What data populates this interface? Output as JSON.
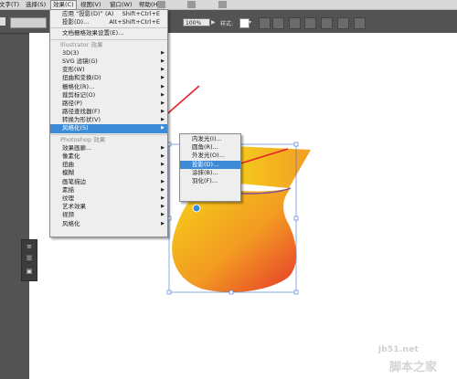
{
  "menubar": {
    "items": [
      "文字(T)",
      "选择(S)",
      "效果(C)",
      "视图(V)",
      "窗口(W)",
      "帮助(H)"
    ],
    "active": "效果(C)"
  },
  "controlbar": {
    "opacity": "100%",
    "style_label": "样式:"
  },
  "effect_menu": {
    "apply_last": "应用 “投影(D)” (A)",
    "apply_last_shortcut": "Shift+Ctrl+E",
    "last_effect": "投影(D)...",
    "last_effect_shortcut": "Alt+Shift+Ctrl+E",
    "doc_raster": "文档栅格效果设置(E)...",
    "illustrator_header": "Illustrator 效果",
    "illustrator_items": [
      "3D(3)",
      "SVG 滤镜(G)",
      "变形(W)",
      "扭曲和变换(D)",
      "栅格化(R)...",
      "裁剪标记(O)",
      "路径(P)",
      "路径查找器(F)",
      "转换为形状(V)",
      "风格化(S)"
    ],
    "photoshop_header": "Photoshop 效果",
    "photoshop_items": [
      "效果画廊...",
      "像素化",
      "扭曲",
      "模糊",
      "画笔描边",
      "素描",
      "纹理",
      "艺术效果",
      "视频",
      "风格化"
    ]
  },
  "stylize_submenu": {
    "items": [
      "内发光(I)...",
      "圆角(R)...",
      "外发光(O)...",
      "投影(D)...",
      "涂抹(B)...",
      "羽化(F)..."
    ],
    "highlighted": "投影(D)..."
  },
  "colors": {
    "highlight": "#3d8bd6",
    "arrow": "#e8202a",
    "bag_top": "#f2c215",
    "bag_bottom": "#e8412a",
    "selection": "#3b6fd6"
  },
  "watermark": {
    "domain": "jb51.net",
    "name": "脚本之家"
  }
}
